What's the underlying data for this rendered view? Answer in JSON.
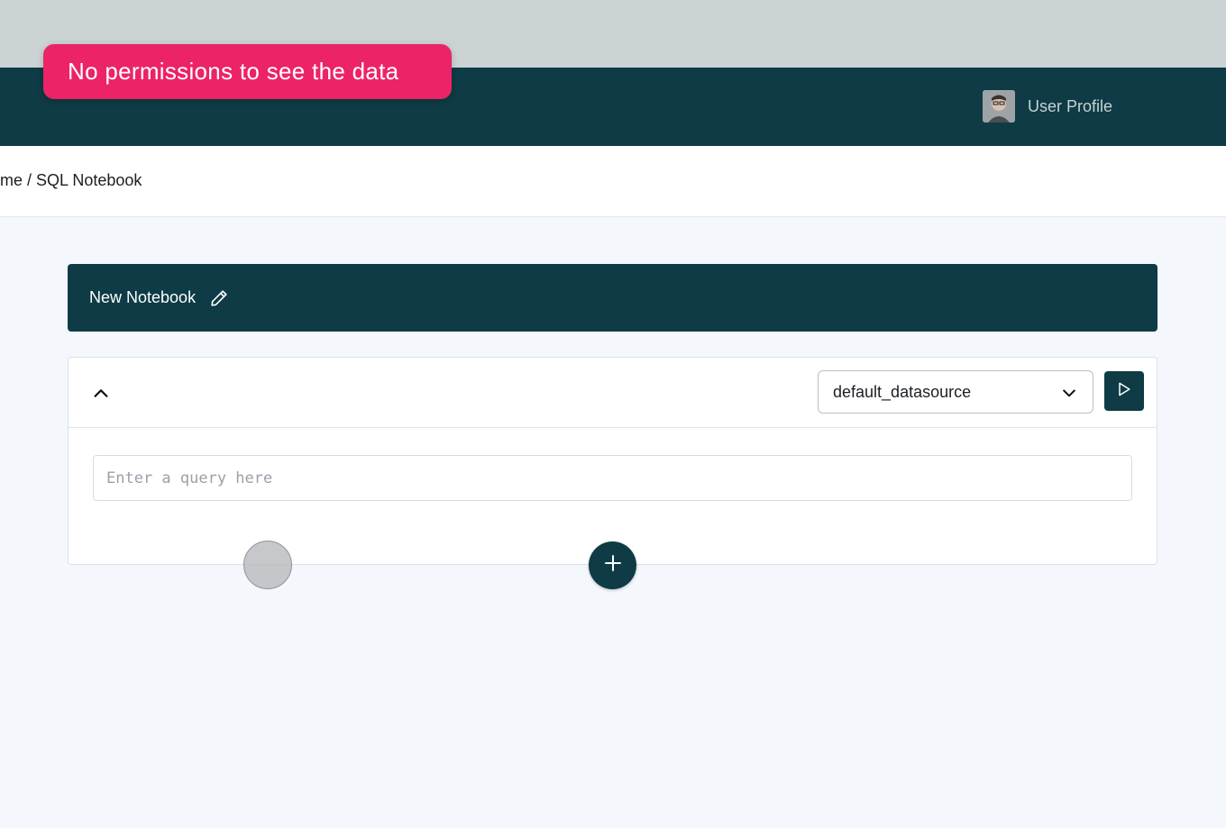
{
  "toast": {
    "message": "No permissions to see the data",
    "color": "#ec2366"
  },
  "header": {
    "profile_label": "User Profile",
    "avatar_icon": "user-avatar",
    "color": "#0e3b45"
  },
  "breadcrumb": {
    "text": "me / SQL Notebook"
  },
  "notebook": {
    "title": "New Notebook",
    "edit_icon": "pencil-icon"
  },
  "cell": {
    "collapse_icon": "chevron-up-icon",
    "datasource": {
      "selected": "default_datasource",
      "icon": "chevron-down-icon"
    },
    "run_icon": "play-icon",
    "query": {
      "value": "",
      "placeholder": "Enter a query here"
    }
  },
  "add_cell_icon": "plus-icon"
}
